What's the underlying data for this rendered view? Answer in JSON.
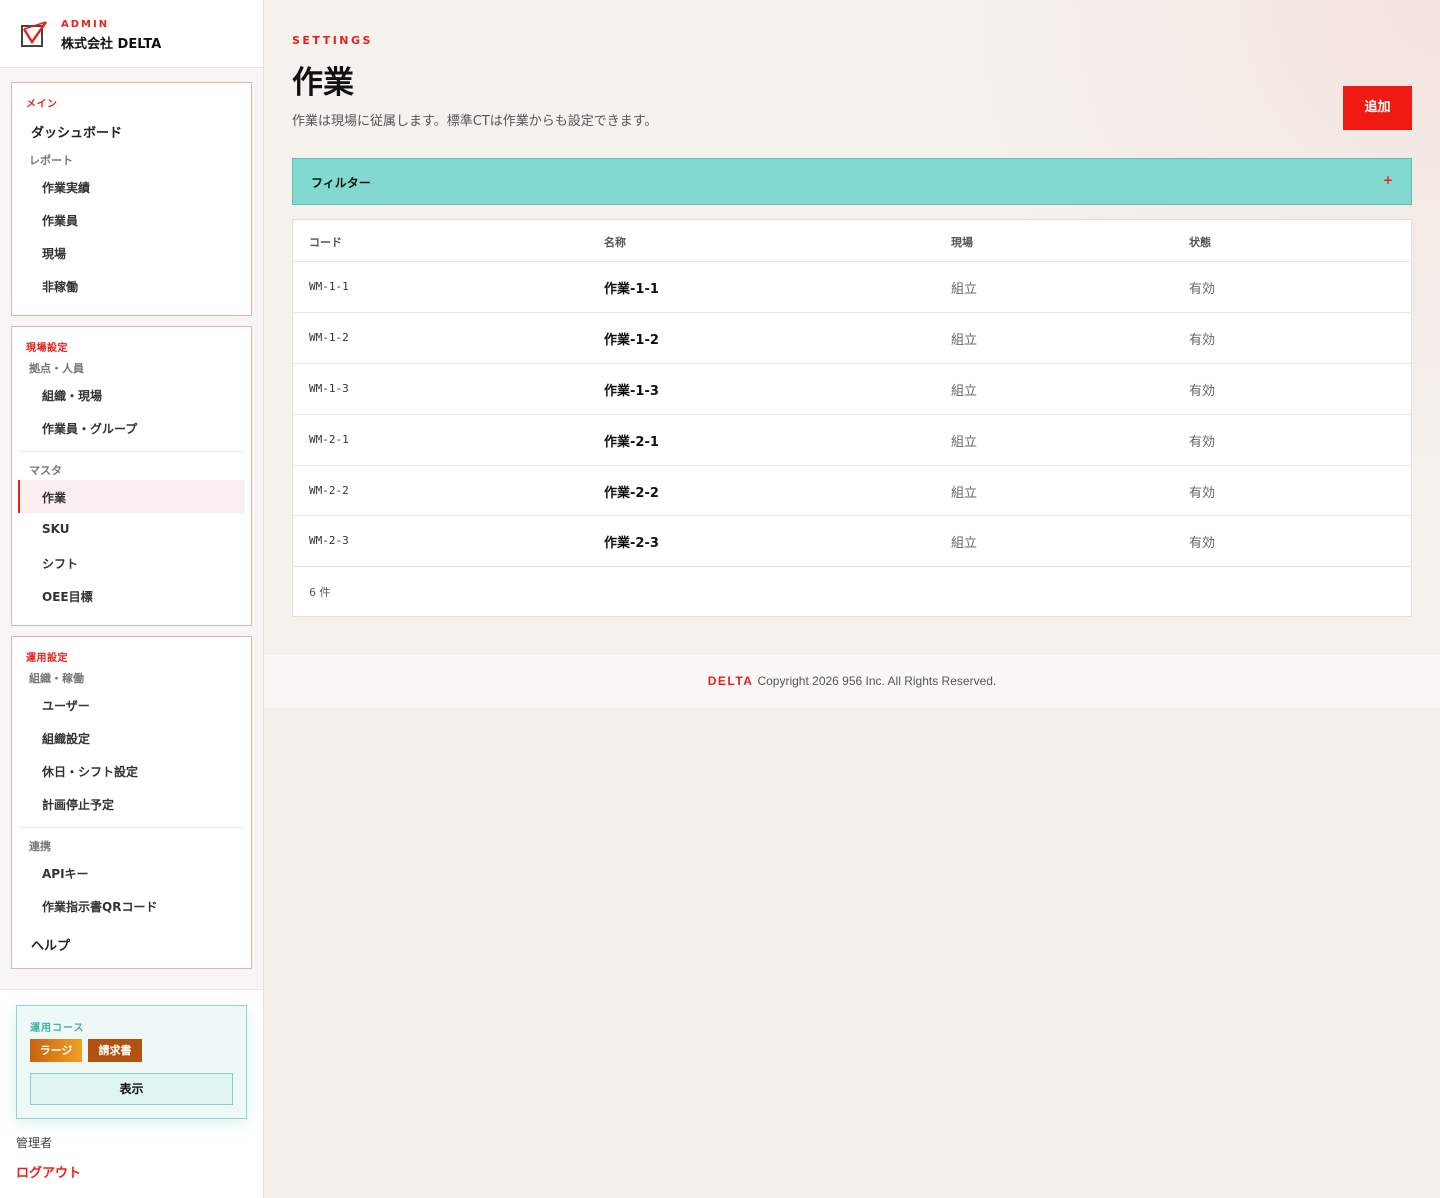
{
  "brand": {
    "admin_label": "ADMIN",
    "company": "株式会社 DELTA"
  },
  "sidebar": {
    "main": {
      "title": "メイン",
      "dashboard": "ダッシュボード",
      "reports_label": "レポート",
      "items": [
        "作業実績",
        "作業員",
        "現場",
        "非稼働"
      ]
    },
    "site": {
      "title": "現場設定",
      "base_label": "拠点・人員",
      "base_items": [
        "組織・現場",
        "作業員・グループ"
      ],
      "master_label": "マスタ",
      "master_items": [
        "作業",
        "SKU",
        "シフト",
        "OEE目標"
      ]
    },
    "ops": {
      "title": "運用設定",
      "org_label": "組織・稼働",
      "org_items": [
        "ユーザー",
        "組織設定",
        "休日・シフト設定",
        "計画停止予定"
      ],
      "link_label": "連携",
      "link_items": [
        "APIキー",
        "作業指示書QRコード"
      ],
      "help": "ヘルプ"
    },
    "plan": {
      "title": "運用コース",
      "badges": [
        "ラージ",
        "請求書"
      ],
      "show_button": "表示"
    },
    "user_role": "管理者",
    "logout": "ログアウト"
  },
  "header": {
    "eyebrow": "SETTINGS",
    "title": "作業",
    "description": "作業は現場に従属します。標準CTは作業からも設定できます。",
    "add_button": "追加"
  },
  "filter": {
    "label": "フィルター",
    "toggle": "+"
  },
  "table": {
    "columns": [
      "コード",
      "名称",
      "現場",
      "状態"
    ],
    "rows": [
      [
        "WM-1-1",
        "作業-1-1",
        "組立",
        "有効"
      ],
      [
        "WM-1-2",
        "作業-1-2",
        "組立",
        "有効"
      ],
      [
        "WM-1-3",
        "作業-1-3",
        "組立",
        "有効"
      ],
      [
        "WM-2-1",
        "作業-2-1",
        "組立",
        "有効"
      ],
      [
        "WM-2-2",
        "作業-2-2",
        "組立",
        "有効"
      ],
      [
        "WM-2-3",
        "作業-2-3",
        "組立",
        "有効"
      ]
    ],
    "count": "6 件"
  },
  "footer": {
    "brand": "DELTA",
    "copyright": "Copyright 2026 956 Inc. All Rights Reserved."
  },
  "colors": {
    "accent": "#e8221b",
    "teal": "#82d9cf"
  }
}
